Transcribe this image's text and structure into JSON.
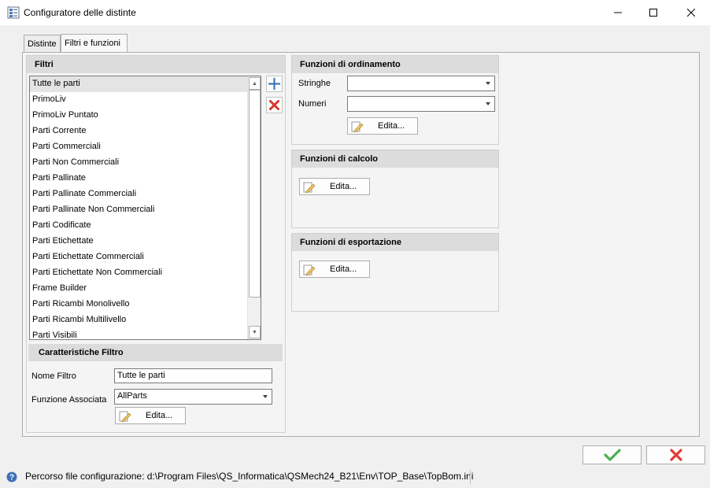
{
  "window": {
    "title": "Configuratore delle distinte",
    "minimize_icon": "minimize-icon",
    "maximize_icon": "maximize-icon",
    "close_icon": "close-icon"
  },
  "tabs": [
    {
      "label": "Distinte",
      "active": false
    },
    {
      "label": "Filtri e funzioni",
      "active": true
    }
  ],
  "filters": {
    "header": "Filtri",
    "items": [
      "Tutte le parti",
      "PrimoLiv",
      "PrimoLiv Puntato",
      "Parti Corrente",
      "Parti Commerciali",
      "Parti Non Commerciali",
      "Parti Pallinate",
      "Parti Pallinate Commerciali",
      "Parti Pallinate Non Commerciali",
      "Parti Codificate",
      "Parti Etichettate",
      "Parti Etichettate Commerciali",
      "Parti Etichettate Non Commerciali",
      "Frame Builder",
      "Parti Ricambi Monolivello",
      "Parti Ricambi Multilivello",
      "Parti Visibili"
    ],
    "selected_index": 0,
    "add_icon": "plus-icon",
    "delete_icon": "delete-x-icon"
  },
  "filter_props": {
    "header": "Caratteristiche Filtro",
    "name_label": "Nome Filtro",
    "name_value": "Tutte le parti",
    "func_label": "Funzione Associata",
    "func_value": "AllParts",
    "edit_label": "Edita..."
  },
  "sort": {
    "header": "Funzioni di ordinamento",
    "strings_label": "Stringhe",
    "strings_value": "",
    "numbers_label": "Numeri",
    "numbers_value": "",
    "edit_label": "Edita..."
  },
  "calc": {
    "header": "Funzioni di calcolo",
    "edit_label": "Edita..."
  },
  "export": {
    "header": "Funzioni di esportazione",
    "edit_label": "Edita..."
  },
  "dialog": {
    "ok_icon": "checkmark-icon",
    "cancel_icon": "cancel-x-icon",
    "ok_color": "#4caf50",
    "cancel_color": "#e53935"
  },
  "status": {
    "icon": "help-icon",
    "text": "Percorso file configurazione: d:\\Program Files\\QS_Informatica\\QSMech24_B21\\Env\\TOP_Base\\TopBom.ini"
  }
}
